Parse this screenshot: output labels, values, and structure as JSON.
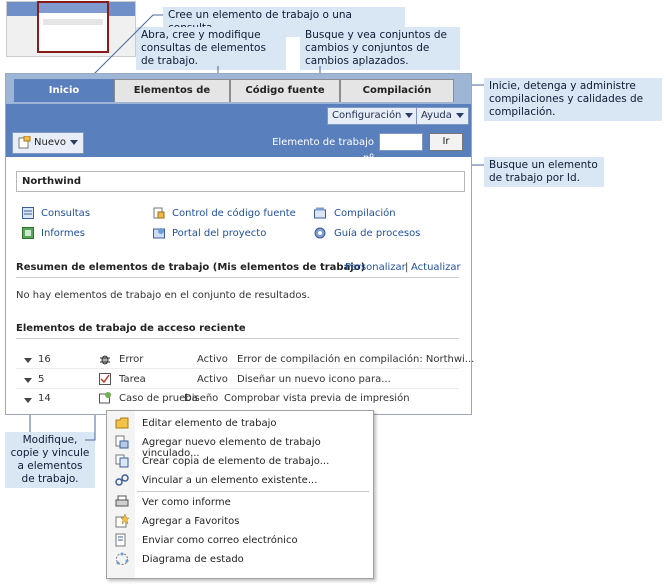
{
  "callouts": {
    "create": "Cree un elemento de trabajo o una consulta.",
    "queries": "Abra, cree y modifique consultas de elementos de trabajo.",
    "changesets": "Busque y vea conjuntos de cambios y conjuntos de cambios aplazados.",
    "builds": "Inicie, detenga y administre compilaciones y calidades de compilación.",
    "find_id": "Busque un elemento de trabajo por Id.",
    "modify": "Modifique, copie y vincule a elementos de trabajo."
  },
  "tabs": [
    "Inicio",
    "Elementos de trabajo",
    "Código fuente",
    "Compilación"
  ],
  "toolbar": {
    "config": "Configuración",
    "help": "Ayuda",
    "new": "Nuevo",
    "wi_label": "Elemento de trabajo nº",
    "go": "Ir"
  },
  "project": "Northwind",
  "links": [
    {
      "label": "Consultas",
      "icon": "queries-icon"
    },
    {
      "label": "Informes",
      "icon": "reports-icon"
    },
    {
      "label": "Control de código fuente",
      "icon": "source-control-icon"
    },
    {
      "label": "Portal del proyecto",
      "icon": "portal-icon"
    },
    {
      "label": "Compilación",
      "icon": "build-icon"
    },
    {
      "label": "Guía de procesos",
      "icon": "process-guide-icon"
    }
  ],
  "summary": {
    "title": "Resumen de elementos de trabajo (Mis elementos de trabajo)",
    "customize": "Personalizar",
    "sep": "|",
    "refresh": "Actualizar",
    "empty": "No hay elementos de trabajo en el conjunto de resultados."
  },
  "recent": {
    "title": "Elementos de trabajo de acceso reciente",
    "rows": [
      {
        "id": "16",
        "type": "Error",
        "state": "Activo",
        "title": "Error de compilación en compilación: Northwi..."
      },
      {
        "id": "5",
        "type": "Tarea",
        "state": "Activo",
        "title": "Diseñar un nuevo icono para..."
      },
      {
        "id": "14",
        "type": "Caso de prueba",
        "state": "Diseño",
        "title": "Comprobar vista previa de impresión"
      }
    ]
  },
  "menu": [
    "Editar elemento de trabajo",
    "Agregar nuevo elemento de trabajo vinculado...",
    "Crear copia de elemento de trabajo...",
    "Vincular a un elemento existente...",
    "Ver como informe",
    "Agregar a Favoritos",
    "Enviar como correo electrónico",
    "Diagrama de estado"
  ]
}
